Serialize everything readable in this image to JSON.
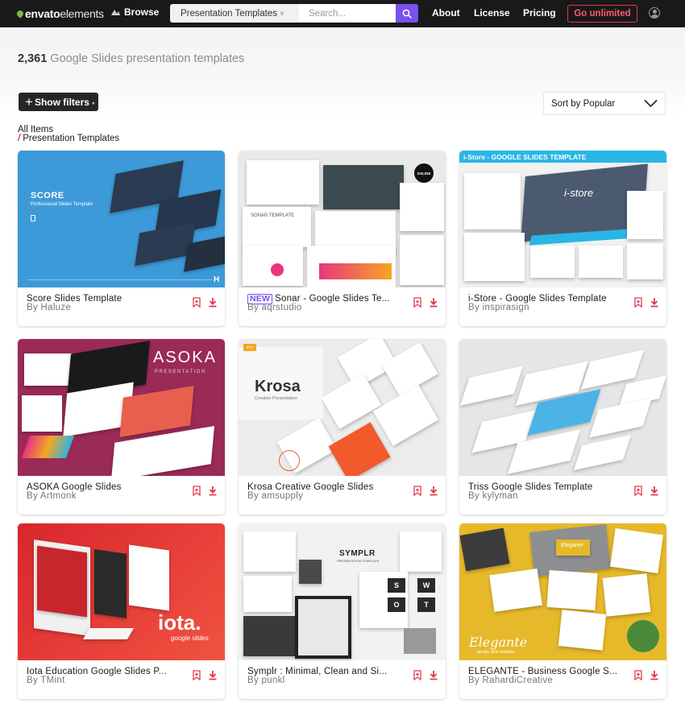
{
  "nav": {
    "logo_envato": "envato",
    "logo_elements": "elements",
    "browse_label": "Browse",
    "search_category": "Presentation Templates",
    "search_placeholder": "Search...",
    "links": [
      "About",
      "License",
      "Pricing"
    ],
    "cta_label": "Go unlimited"
  },
  "header": {
    "count": "2,361",
    "description": "Google Slides presentation templates"
  },
  "toolbar": {
    "filters_label": "Show filters",
    "sort_label": "Sort by Popular"
  },
  "breadcrumb": {
    "all": "All Items",
    "current": "Presentation Templates"
  },
  "colors": {
    "nav_bg": "#191919",
    "accent_purple": "#7b4ff0",
    "accent_red": "#e0384d",
    "leaf_green": "#82b541"
  },
  "cards": [
    {
      "title": "Score Slides Template",
      "author": "By Haluze",
      "is_new": false,
      "thumb": {
        "heading": "SCORE",
        "sub": "Professional Slides Template",
        "sub_bold": "Slides Template",
        "badge": "H",
        "bg": "#3d9ad8"
      }
    },
    {
      "title": "Sonar - Google Slides Te...",
      "author": "By aqrstudio",
      "is_new": true,
      "new_label": "NEW",
      "thumb": {
        "heading": "SONAR TEMPLATE",
        "badge": "GSLIDE",
        "bg": "#e9e9e9"
      }
    },
    {
      "title": "i-Store - Google Slides Template",
      "author": "By inspirasign",
      "is_new": false,
      "thumb": {
        "heading": "i-Store - GOOGLE SLIDES TEMPLATE",
        "logo": "i-store",
        "bg": "#f1f1f1",
        "band": "#29b6e6"
      }
    },
    {
      "title": "ASOKA Google Slides",
      "author": "By Artmonk",
      "is_new": false,
      "thumb": {
        "heading": "ASOKA",
        "sub": "PRESENTATION",
        "bg": "#9a2b57"
      }
    },
    {
      "title": "Krosa Creative Google Slides",
      "author": "By amsupply",
      "is_new": false,
      "thumb": {
        "heading": "Krosa",
        "sub": "Creative Presentation",
        "badge": "PPT",
        "bg": "#ececec"
      }
    },
    {
      "title": "Triss Google Slides Template",
      "author": "By kylyman",
      "is_new": false,
      "thumb": {
        "bg": "#e6e6e6"
      }
    },
    {
      "title": "Iota Education Google Slides P...",
      "author": "By TMint",
      "is_new": false,
      "thumb": {
        "heading": "iota.",
        "sub": "google slides",
        "bg": "#e5342e"
      }
    },
    {
      "title": "Symplr : Minimal, Clean and Si...",
      "author": "By punkl",
      "is_new": false,
      "thumb": {
        "heading": "SYMPLR",
        "sub": "PRESENTATION TEMPLATE",
        "letters": [
          "S",
          "W",
          "O",
          "T"
        ],
        "bg": "#f2f2f2"
      }
    },
    {
      "title": "ELEGANTE - Business Google S...",
      "author": "By RahardiCreative",
      "is_new": false,
      "thumb": {
        "heading": "Elegante",
        "sub": "google slide template",
        "bg": "#e6b92a"
      }
    }
  ]
}
